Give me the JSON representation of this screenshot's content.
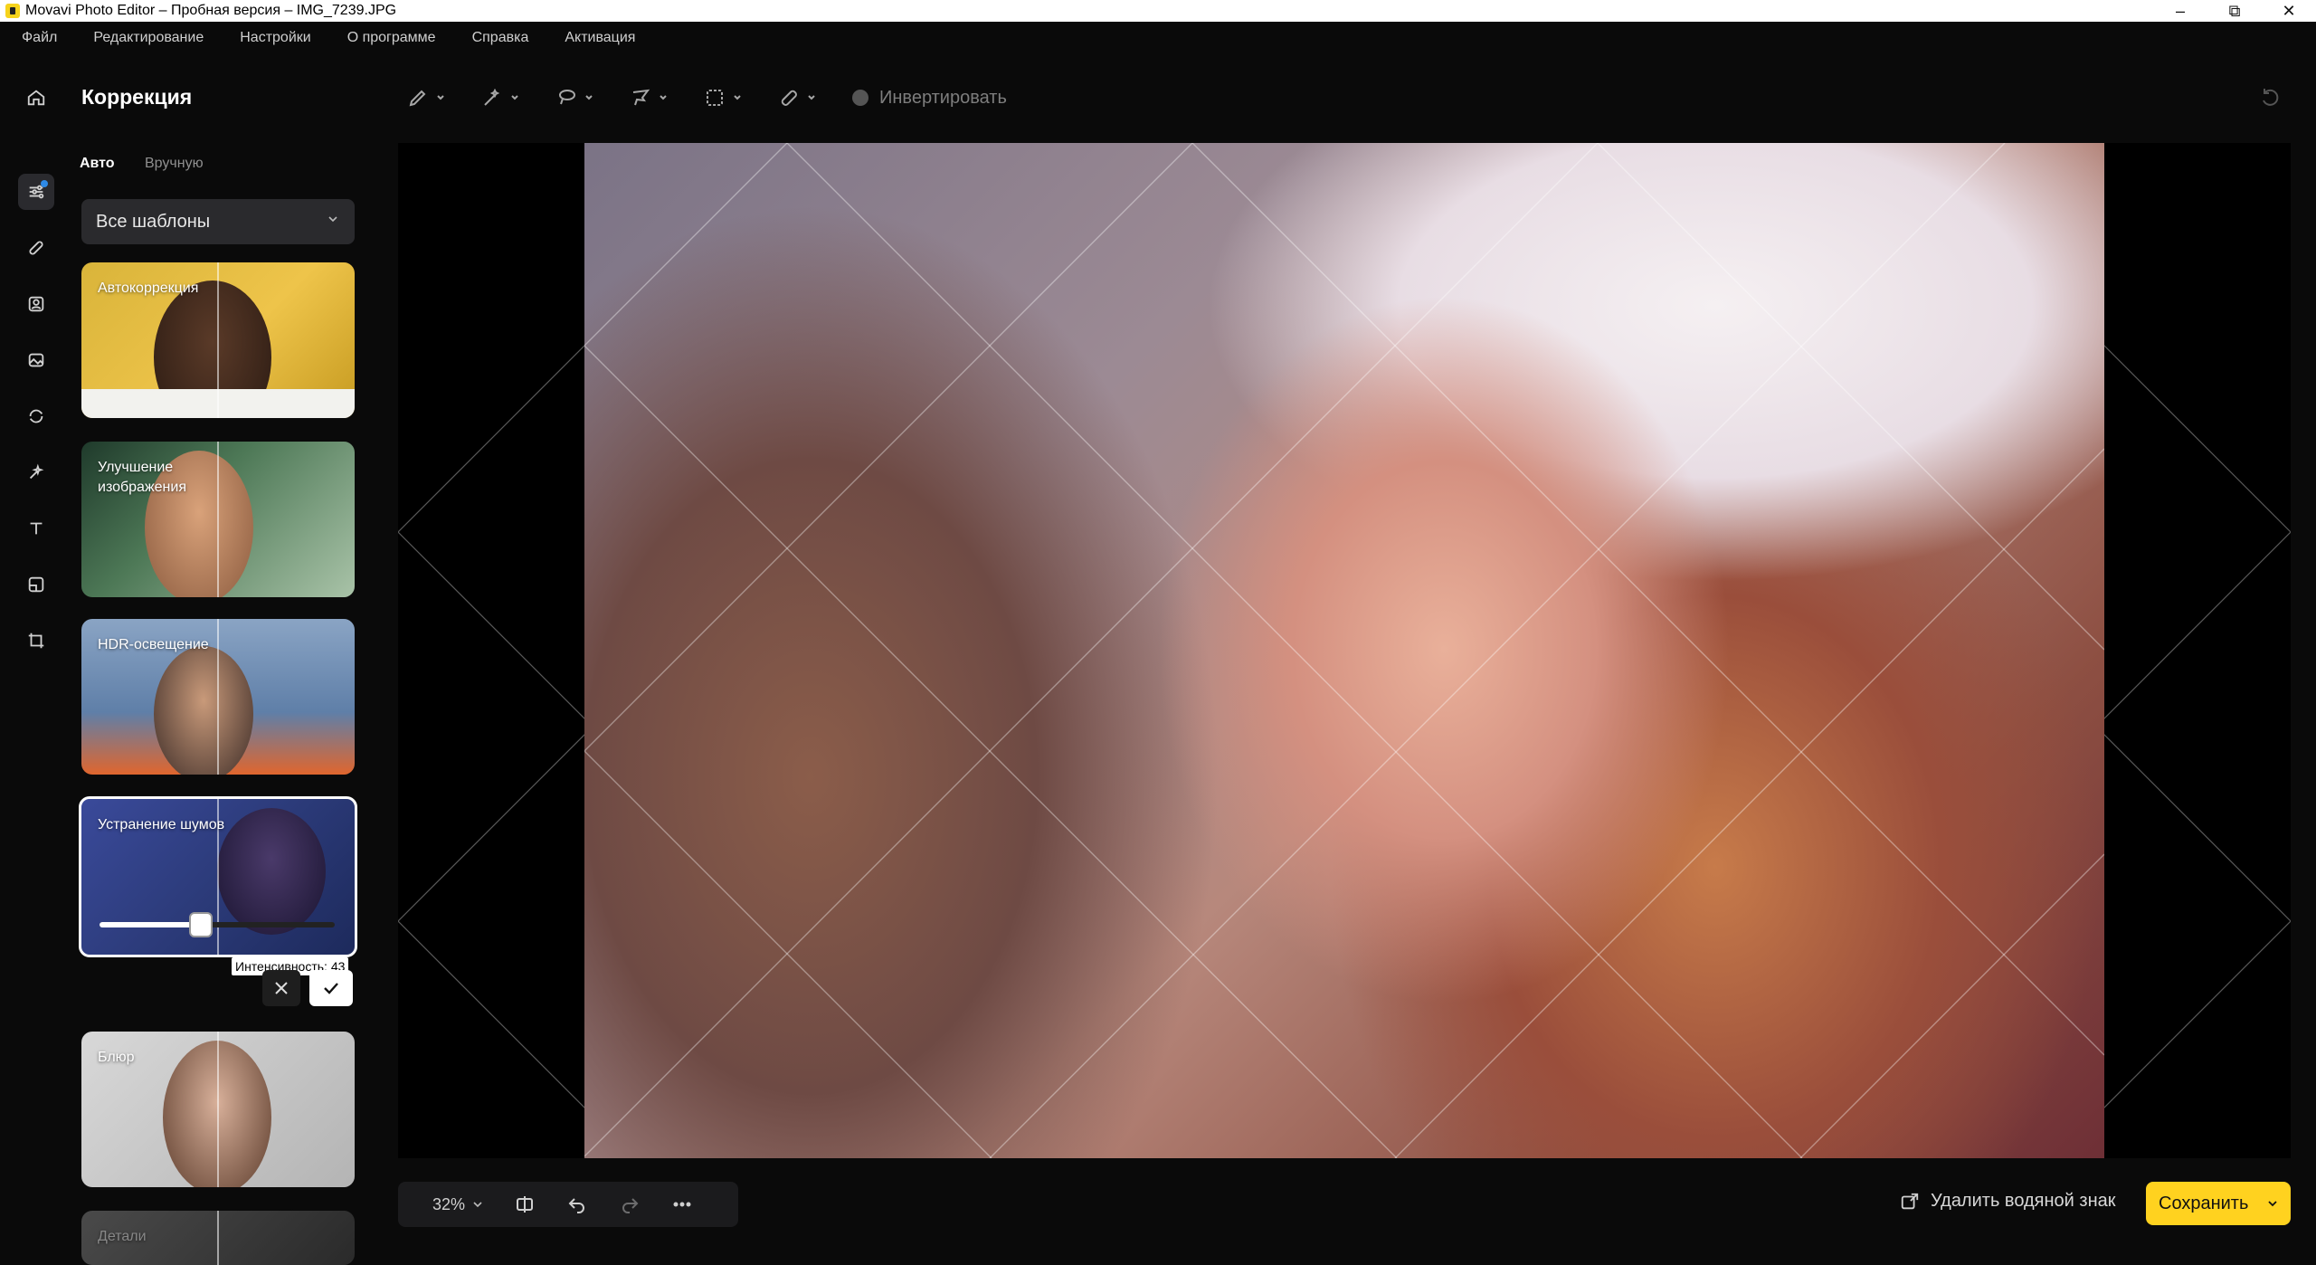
{
  "window": {
    "title": "Movavi Photo Editor – Пробная версия – IMG_7239.JPG",
    "minimize": "–",
    "maximize": "⧉",
    "close": "✕"
  },
  "menu": [
    "Файл",
    "Редактирование",
    "Настройки",
    "О программе",
    "Справка",
    "Активация"
  ],
  "panel": {
    "title": "Коррекция",
    "tabs": {
      "auto": "Авто",
      "manual": "Вручную"
    },
    "templates_select": "Все шаблоны",
    "cards": {
      "auto": "Автокоррекция",
      "enhance": "Улучшение изображения",
      "hdr": "HDR-освещение",
      "noise": "Устранение шумов",
      "blur": "Блюр",
      "details": "Детали"
    },
    "intensity_tooltip": "Интенсивность: 43",
    "intensity_value": 43
  },
  "toolbar": {
    "invert_label": "Инвертировать"
  },
  "bottom": {
    "zoom": "32%",
    "remove_watermark": "Удалить водяной знак",
    "save": "Сохранить"
  },
  "colors": {
    "accent": "#ffd21f",
    "active_dot": "#2e8ae6"
  }
}
